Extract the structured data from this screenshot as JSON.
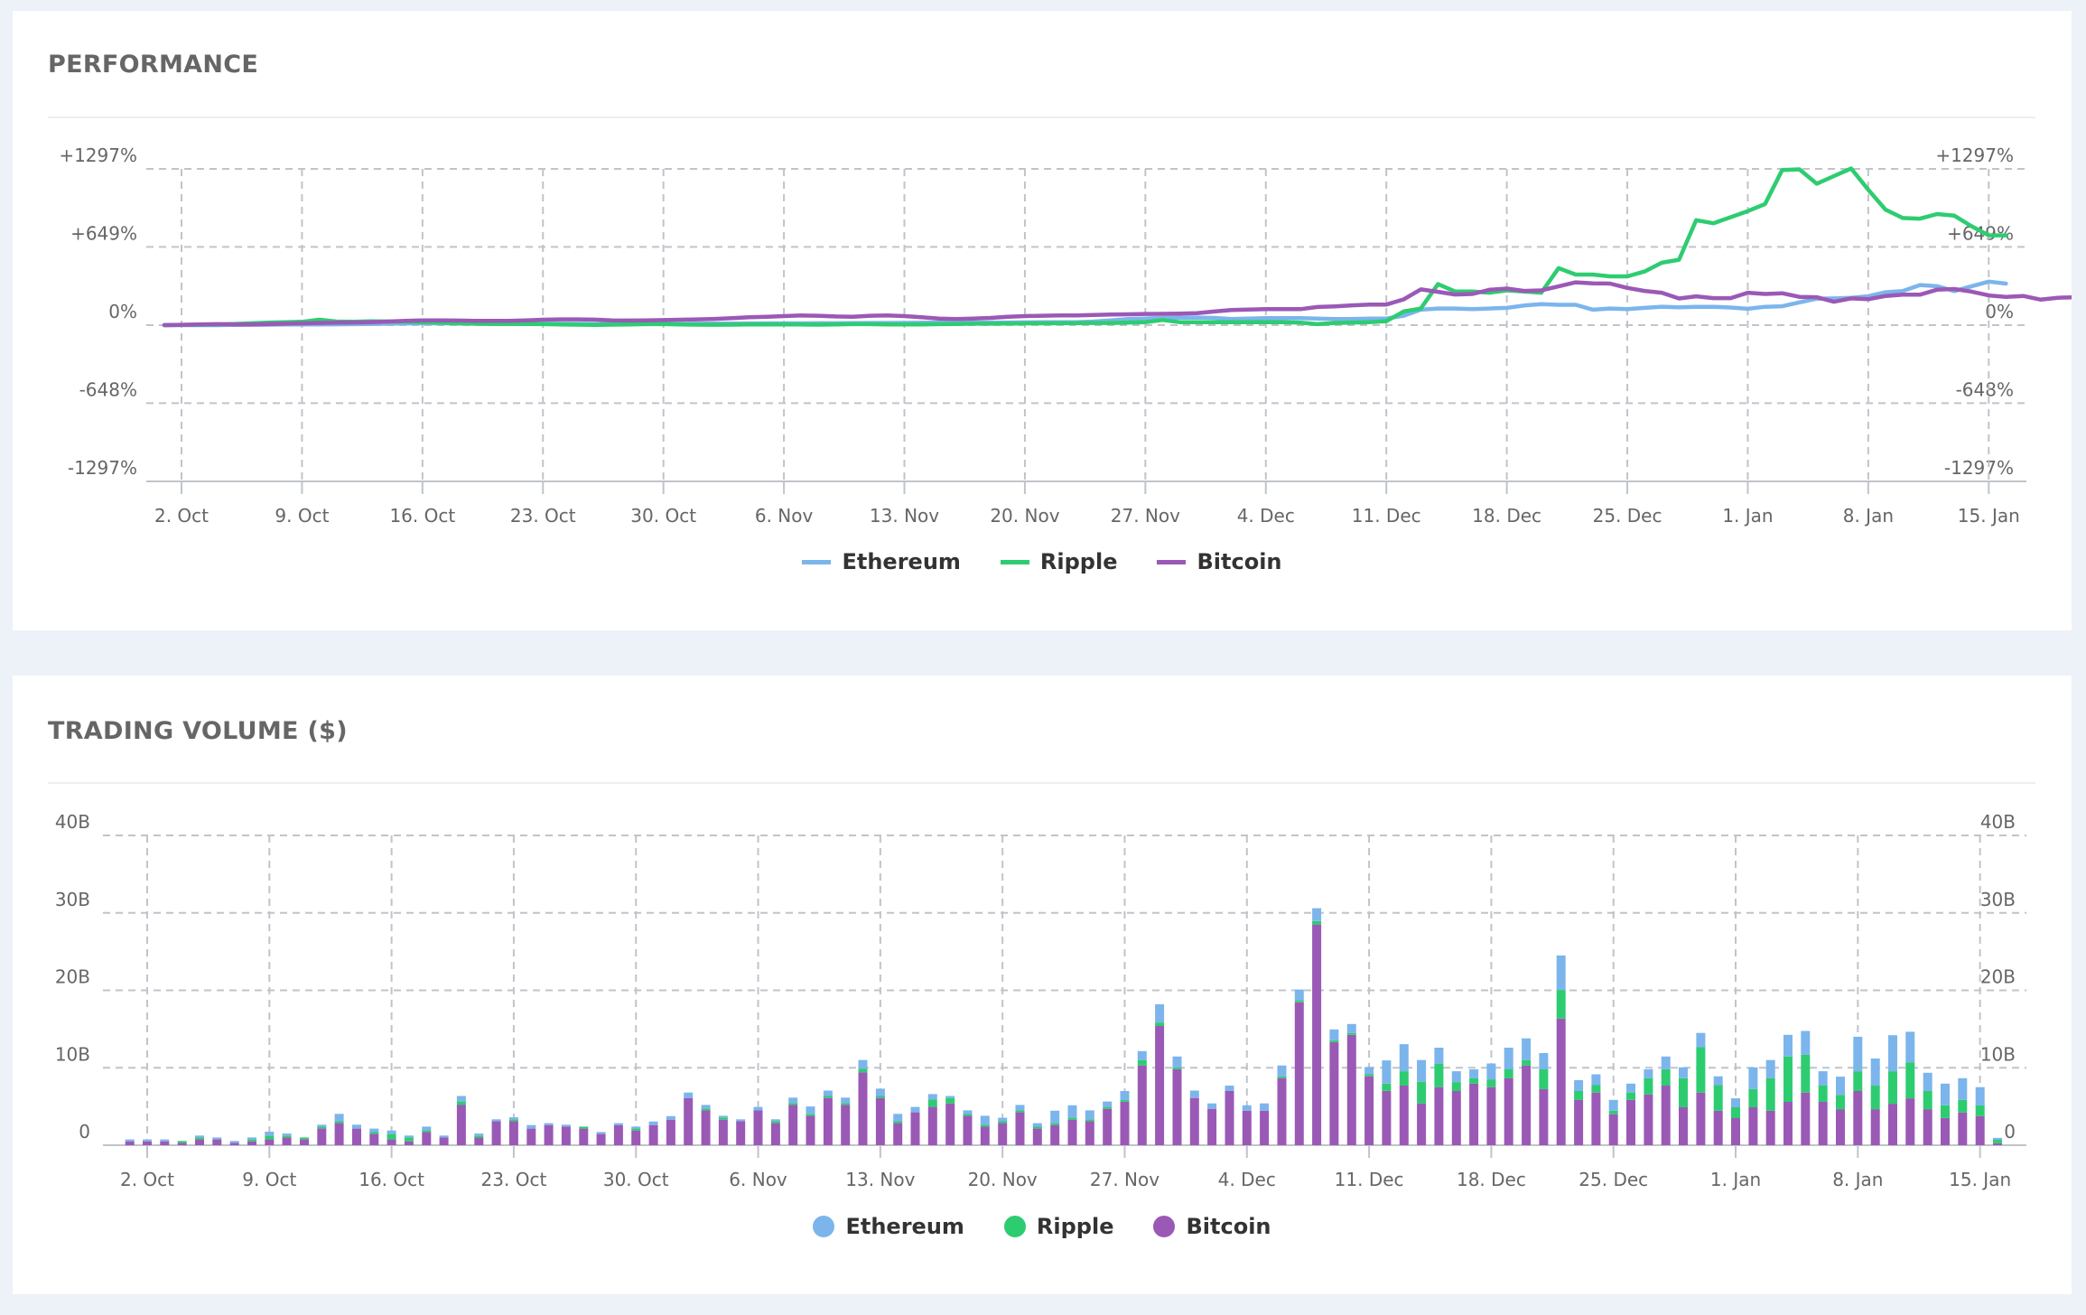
{
  "colors": {
    "ethereum": "#7cb5ec",
    "ripple": "#2ecc71",
    "bitcoin": "#9b59b6"
  },
  "chart_data": [
    {
      "id": "performance",
      "type": "line",
      "title": "PERFORMANCE",
      "xlabel": "",
      "ylabel": "",
      "x_start": "1. Oct",
      "x_end": "16. Jan",
      "x_ticks": [
        "2. Oct",
        "9. Oct",
        "16. Oct",
        "23. Oct",
        "30. Oct",
        "6. Nov",
        "13. Nov",
        "20. Nov",
        "27. Nov",
        "4. Dec",
        "11. Dec",
        "18. Dec",
        "25. Dec",
        "1. Jan",
        "8. Jan",
        "15. Jan"
      ],
      "y_ticks_left": [
        "+1297%",
        "+649%",
        "0%",
        "-648%",
        "-1297%"
      ],
      "y_ticks_right": [
        "+1297%",
        "+649%",
        "0%",
        "-648%",
        "-1297%"
      ],
      "y_tick_values": [
        1297,
        649,
        0,
        -648,
        -1297
      ],
      "ylim": [
        -1297,
        1297
      ],
      "grid": true,
      "legend_position": "bottom-center",
      "legend": [
        "Ethereum",
        "Ripple",
        "Bitcoin"
      ],
      "series": [
        {
          "name": "Ethereum",
          "color": "#7cb5ec",
          "values": [
            0,
            0,
            0,
            0,
            2,
            3,
            4,
            5,
            6,
            6,
            7,
            8,
            10,
            12,
            14,
            15,
            15,
            14,
            13,
            12,
            12,
            12,
            12,
            12,
            11,
            10,
            10,
            10,
            10,
            10,
            11,
            12,
            13,
            13,
            14,
            15,
            15,
            15,
            16,
            16,
            17,
            18,
            18,
            19,
            20,
            20,
            21,
            21,
            22,
            22,
            23,
            24,
            24,
            25,
            30,
            40,
            50,
            55,
            60,
            62,
            63,
            60,
            50,
            55,
            58,
            58,
            58,
            55,
            50,
            50,
            55,
            55,
            78,
            128,
            138,
            138,
            133,
            138,
            143,
            163,
            174,
            169,
            169,
            128,
            138,
            133,
            143,
            153,
            148,
            152,
            152,
            146,
            136,
            152,
            157,
            189,
            220,
            222,
            227,
            240,
            273,
            283,
            333,
            323,
            283,
            323,
            361,
            345
          ]
        },
        {
          "name": "Ripple",
          "color": "#2ecc71",
          "values": [
            0,
            2,
            4,
            6,
            10,
            15,
            20,
            25,
            28,
            45,
            30,
            28,
            32,
            30,
            28,
            25,
            20,
            15,
            12,
            10,
            10,
            10,
            8,
            6,
            4,
            2,
            4,
            6,
            8,
            8,
            6,
            4,
            3,
            4,
            5,
            6,
            6,
            5,
            4,
            6,
            8,
            8,
            6,
            5,
            6,
            8,
            10,
            12,
            12,
            13,
            14,
            15,
            16,
            17,
            18,
            18,
            20,
            25,
            43,
            25,
            25,
            25,
            25,
            25,
            25,
            25,
            20,
            8,
            18,
            20,
            25,
            33,
            113,
            138,
            340,
            279,
            279,
            269,
            289,
            279,
            269,
            473,
            420,
            420,
            405,
            405,
            445,
            518,
            543,
            871,
            846,
            896,
            947,
            1005,
            1288,
            1293,
            1174,
            1237,
            1300,
            1124,
            959,
            889,
            884,
            922,
            909,
            821,
            745,
            745
          ]
        },
        {
          "name": "Bitcoin",
          "color": "#9b59b6",
          "values": [
            0,
            3,
            5,
            8,
            6,
            5,
            8,
            12,
            15,
            18,
            20,
            22,
            25,
            30,
            35,
            40,
            40,
            38,
            36,
            35,
            36,
            40,
            45,
            48,
            48,
            46,
            40,
            38,
            40,
            42,
            45,
            48,
            52,
            58,
            65,
            70,
            75,
            80,
            78,
            72,
            70,
            78,
            80,
            75,
            65,
            55,
            50,
            55,
            60,
            70,
            75,
            78,
            80,
            81,
            85,
            88,
            90,
            93,
            94,
            96,
            100,
            113,
            126,
            130,
            133,
            133,
            133,
            151,
            156,
            164,
            171,
            171,
            214,
            297,
            277,
            254,
            259,
            294,
            304,
            284,
            289,
            322,
            355,
            347,
            345,
            309,
            284,
            269,
            221,
            239,
            224,
            224,
            269,
            259,
            265,
            235,
            232,
            194,
            222,
            215,
            242,
            253,
            253,
            295,
            300,
            278,
            247,
            235,
            242,
            212,
            227,
            232,
            220
          ]
        }
      ]
    },
    {
      "id": "volume",
      "type": "bar",
      "stacked": true,
      "title": "TRADING VOLUME ($)",
      "xlabel": "",
      "ylabel": "",
      "x_start": "1. Oct",
      "x_end": "16. Jan",
      "x_ticks": [
        "2. Oct",
        "9. Oct",
        "16. Oct",
        "23. Oct",
        "30. Oct",
        "6. Nov",
        "13. Nov",
        "20. Nov",
        "27. Nov",
        "4. Dec",
        "11. Dec",
        "18. Dec",
        "25. Dec",
        "1. Jan",
        "8. Jan",
        "15. Jan"
      ],
      "y_ticks_left": [
        "40B",
        "30B",
        "20B",
        "10B",
        "0"
      ],
      "y_ticks_right": [
        "40B",
        "30B",
        "20B",
        "10B",
        "0"
      ],
      "y_tick_values": [
        40,
        30,
        20,
        10,
        0
      ],
      "unit": "billion USD",
      "ylim": [
        0,
        40
      ],
      "grid": true,
      "legend_position": "bottom-center",
      "legend": [
        "Ethereum",
        "Ripple",
        "Bitcoin"
      ],
      "stack_order_bottom_to_top": [
        "Bitcoin",
        "Ripple",
        "Ethereum"
      ],
      "series": [
        {
          "name": "Bitcoin",
          "color": "#9b59b6",
          "values": [
            0.5,
            0.5,
            0.5,
            0.3,
            0.75,
            0.75,
            0.3,
            0.5,
            0.75,
            1.0,
            0.75,
            2.15,
            2.85,
            2.15,
            1.45,
            0.75,
            0.5,
            1.7,
            1.0,
            5.2,
            1.0,
            3.1,
            3.1,
            2.15,
            2.6,
            2.4,
            2.15,
            1.45,
            2.6,
            1.9,
            2.6,
            3.3,
            6.1,
            4.5,
            3.3,
            3.1,
            4.5,
            2.85,
            5.2,
            3.8,
            6.1,
            5.2,
            9.4,
            6.1,
            2.85,
            4.25,
            4.95,
            5.4,
            3.8,
            2.4,
            2.85,
            4.25,
            2.15,
            2.6,
            3.3,
            3.1,
            4.7,
            5.6,
            10.3,
            15.4,
            9.8,
            6.1,
            4.7,
            7.0,
            4.45,
            4.45,
            8.65,
            18.45,
            28.5,
            13.3,
            14.25,
            8.9,
            7.0,
            7.7,
            5.4,
            7.5,
            7.0,
            7.95,
            7.5,
            8.65,
            10.3,
            7.25,
            16.35,
            5.85,
            6.8,
            4.0,
            5.85,
            6.55,
            7.7,
            4.9,
            6.8,
            4.45,
            3.5,
            4.9,
            4.45,
            5.6,
            6.8,
            5.6,
            4.65,
            7.0,
            4.65,
            5.35,
            6.05,
            4.65,
            3.5,
            4.2,
            3.75,
            0.25
          ]
        },
        {
          "name": "Ripple",
          "color": "#2ecc71",
          "values": [
            0,
            0,
            0,
            0.25,
            0.25,
            0,
            0,
            0.25,
            0.5,
            0.25,
            0.25,
            0.25,
            0.25,
            0,
            0.25,
            0.7,
            0.5,
            0.25,
            0,
            0.45,
            0.25,
            0,
            0.25,
            0,
            0,
            0,
            0.25,
            0,
            0,
            0.25,
            0,
            0,
            0,
            0.25,
            0.25,
            0,
            0,
            0.25,
            0.25,
            0.25,
            0.25,
            0.25,
            0.45,
            0.25,
            0.25,
            0,
            0.95,
            0.7,
            0.25,
            0.25,
            0.25,
            0.25,
            0.25,
            0.25,
            0.25,
            0.25,
            0.25,
            0.25,
            0.7,
            0.45,
            0.25,
            0,
            0,
            0,
            0,
            0,
            0.25,
            0.25,
            0.45,
            0.25,
            0.25,
            0.25,
            0.95,
            1.85,
            2.8,
            3.0,
            1.15,
            0.7,
            0.95,
            1.15,
            0.7,
            2.55,
            3.7,
            1.15,
            0.95,
            0.45,
            0.95,
            2.1,
            2.1,
            3.75,
            5.85,
            3.3,
            1.4,
            2.35,
            4.2,
            5.85,
            4.9,
            2.1,
            1.85,
            2.55,
            3.05,
            4.2,
            4.65,
            2.35,
            1.65,
            1.65,
            1.4,
            0.45
          ]
        },
        {
          "name": "Ethereum",
          "color": "#7cb5ec",
          "values": [
            0.25,
            0.25,
            0.25,
            0,
            0.25,
            0.25,
            0.25,
            0.25,
            0.5,
            0.25,
            0,
            0.25,
            0.95,
            0.5,
            0.45,
            0.45,
            0.25,
            0.45,
            0.25,
            0.7,
            0.25,
            0.25,
            0.25,
            0.45,
            0.25,
            0.25,
            0,
            0.25,
            0.25,
            0.25,
            0.45,
            0.45,
            0.7,
            0.45,
            0.25,
            0.25,
            0.45,
            0.25,
            0.7,
            0.95,
            0.7,
            0.7,
            1.15,
            0.95,
            0.95,
            0.7,
            0.7,
            0.25,
            0.45,
            1.15,
            0.45,
            0.7,
            0.45,
            1.6,
            1.6,
            1.15,
            0.7,
            1.15,
            1.15,
            2.35,
            1.4,
            0.95,
            0.7,
            0.7,
            0.7,
            0.95,
            1.4,
            1.4,
            1.65,
            1.4,
            1.15,
            0.95,
            3.0,
            3.5,
            2.8,
            2.1,
            1.4,
            1.15,
            2.1,
            2.8,
            2.8,
            2.1,
            4.45,
            1.4,
            1.4,
            1.4,
            1.15,
            1.15,
            1.65,
            1.4,
            1.85,
            1.15,
            1.15,
            2.8,
            2.35,
            2.8,
            3.05,
            1.85,
            2.35,
            4.45,
            3.5,
            4.65,
            3.95,
            2.35,
            2.8,
            2.8,
            2.35,
            0.25
          ]
        }
      ]
    }
  ]
}
